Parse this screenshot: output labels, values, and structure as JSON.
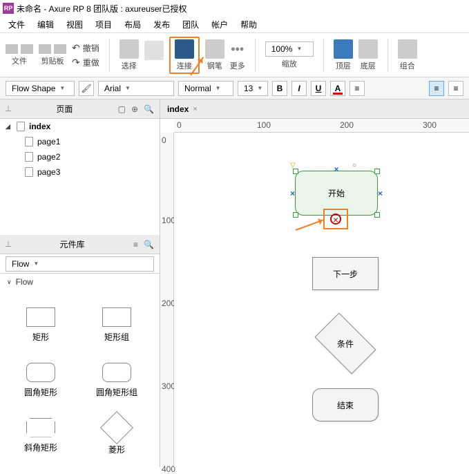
{
  "title": "未命名 - Axure RP 8 团队版 : axureuser已授权",
  "menu": [
    "文件",
    "编辑",
    "视图",
    "项目",
    "布局",
    "发布",
    "团队",
    "帐户",
    "帮助"
  ],
  "toolbar": {
    "file": "文件",
    "clipboard": "剪贴板",
    "undo": "撤销",
    "redo": "重做",
    "select": "选择",
    "connect": "连接",
    "pen": "钢笔",
    "more": "更多",
    "zoom": "缩放",
    "zoom_value": "100%",
    "front": "顶层",
    "back": "底层",
    "group": "组合"
  },
  "format": {
    "shape_type": "Flow Shape",
    "font": "Arial",
    "weight": "Normal",
    "size": "13"
  },
  "pages_panel": {
    "title": "页面",
    "root": "index",
    "children": [
      "page1",
      "page2",
      "page3"
    ]
  },
  "library_panel": {
    "title": "元件库",
    "category": "Flow",
    "group_label": "Flow",
    "items": [
      "矩形",
      "矩形组",
      "圆角矩形",
      "圆角矩形组",
      "斜角矩形",
      "菱形"
    ]
  },
  "tab": {
    "label": "index"
  },
  "ruler_h": [
    "0",
    "100",
    "200",
    "300"
  ],
  "ruler_v": [
    "0",
    "100",
    "200",
    "300",
    "400"
  ],
  "canvas": {
    "start": "开始",
    "next": "下一步",
    "cond": "条件",
    "end": "结束"
  }
}
